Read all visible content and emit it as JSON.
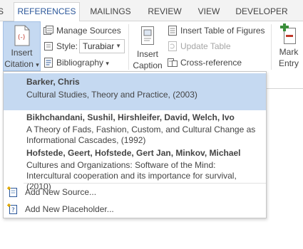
{
  "tabs": [
    {
      "label": "S",
      "active": false
    },
    {
      "label": "REFERENCES",
      "active": true
    },
    {
      "label": "MAILINGS",
      "active": false
    },
    {
      "label": "REVIEW",
      "active": false
    },
    {
      "label": "VIEW",
      "active": false
    },
    {
      "label": "DEVELOPER",
      "active": false
    }
  ],
  "ribbon": {
    "insert_citation": {
      "line1": "Insert",
      "line2": "Citation",
      "arrow": "▾"
    },
    "manage_sources": "Manage Sources",
    "style_label": "Style:",
    "style_value": "Turabiar",
    "bibliography": "Bibliography",
    "bibliography_arrow": "▾",
    "insert_caption": {
      "line1": "Insert",
      "line2": "Caption"
    },
    "insert_table_of_figures": "Insert Table of Figures",
    "update_table": "Update Table",
    "cross_reference": "Cross-reference",
    "mark_entry": {
      "line1": "Mark",
      "line2": "Entry"
    }
  },
  "dropdown": {
    "citations": [
      {
        "author": "Barker, Chris",
        "title": "Cultural Studies, Theory and Practice, (2003)",
        "highlighted": true
      },
      {
        "author": "Bikhchandani, Sushil, Hirshleifer, David,  Welch, Ivo",
        "title": "A Theory of Fads, Fashion, Custom, and Cultural Change as Informational Cascades, (1992)",
        "highlighted": false
      },
      {
        "author": "Hofstede, Geert, Hofstede, Gert Jan,  Minkov, Michael",
        "title": "Cultures and Organizations: Software of the Mind: Intercultural cooperation and its importance for survival, (2010)",
        "highlighted": false
      }
    ],
    "add_new_source": "Add New Source...",
    "add_new_placeholder": "Add New Placeholder..."
  },
  "colors": {
    "accent": "#2b579a",
    "highlight": "#c5d9f1",
    "highlight_border": "#a4c0e4",
    "citation_icon_red": "#c0392b",
    "mark_entry_green": "#3a8e3a"
  },
  "icons": {
    "insert_citation": "citation-document-icon",
    "manage_sources": "manage-sources-icon",
    "style": "style-icon",
    "bibliography": "bibliography-icon",
    "insert_caption": "caption-icon",
    "insert_table_of_figures": "table-of-figures-icon",
    "update_table": "update-table-icon",
    "cross_reference": "cross-reference-icon",
    "mark_entry": "mark-entry-icon",
    "add_new_source": "add-source-icon",
    "add_new_placeholder": "add-placeholder-icon"
  }
}
